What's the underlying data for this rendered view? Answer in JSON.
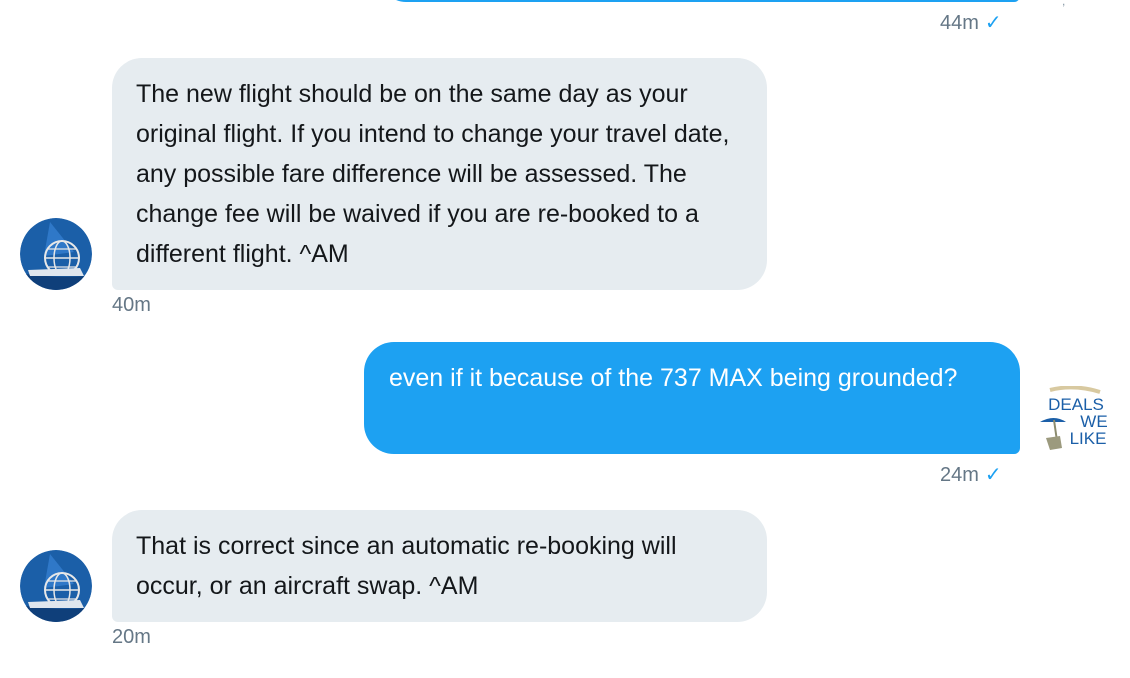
{
  "conversation": {
    "previous": {
      "time": "44m"
    },
    "messages": [
      {
        "direction": "incoming",
        "text": "The new flight should be on the same day as your original flight. If you intend to change your travel date, any possible fare difference will be assessed. The change fee will be waived if you are re-booked to a different flight. ^AM",
        "time": "40m"
      },
      {
        "direction": "outgoing",
        "text": "even if it because of the 737 MAX being grounded?",
        "time": "24m"
      },
      {
        "direction": "incoming",
        "text": "That is correct since an automatic re-booking will occur, or an aircraft swap. ^AM",
        "time": "20m"
      }
    ]
  },
  "avatars": {
    "incoming_icon": "airline-globe-logo",
    "outgoing_icon": "deals-we-like-logo",
    "outgoing_logo_text": [
      "DEALS",
      "WE",
      "LIKE"
    ]
  },
  "colors": {
    "outgoing_bubble": "#1da1f2",
    "incoming_bubble": "#e6ecf0",
    "timestamp": "#657786",
    "read_check": "#1da1f2",
    "logo_blue": "#1b5fa8"
  }
}
